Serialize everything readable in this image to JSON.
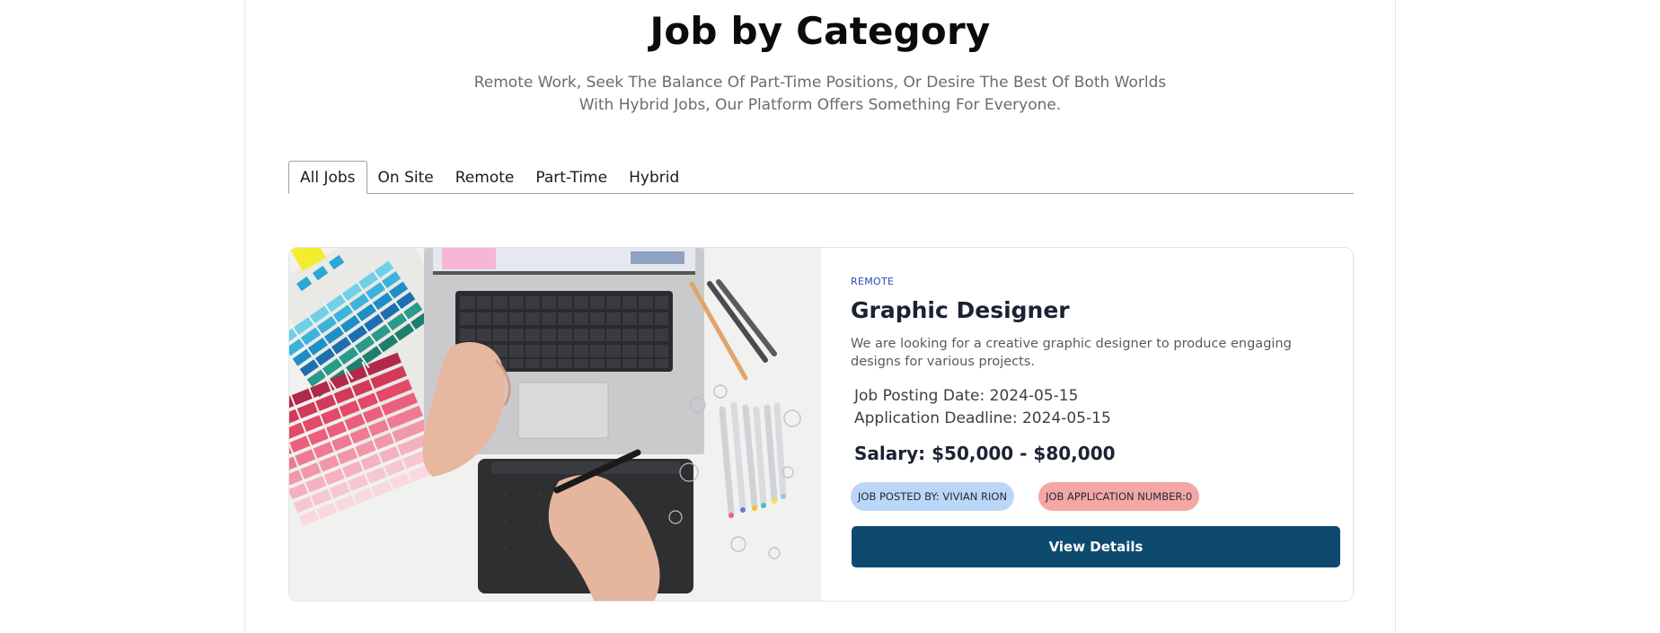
{
  "section": {
    "title": "Job by Category",
    "subtitle": "Remote Work, Seek The Balance Of Part-Time Positions, Or Desire The Best Of Both Worlds With Hybrid Jobs, Our Platform Offers Something For Everyone."
  },
  "tabs": [
    {
      "label": "All Jobs",
      "active": true
    },
    {
      "label": "On Site",
      "active": false
    },
    {
      "label": "Remote",
      "active": false
    },
    {
      "label": "Part-Time",
      "active": false
    },
    {
      "label": "Hybrid",
      "active": false
    }
  ],
  "job": {
    "type": "REMOTE",
    "title": "Graphic Designer",
    "description": "We are looking for a creative graphic designer to produce engaging designs for various projects.",
    "posting_date": "Job Posting Date: 2024-05-15",
    "deadline": "Application Deadline: 2024-05-15",
    "salary": "Salary: $50,000 - $80,000",
    "posted_by": "JOB POSTED BY: VIVIAN RION",
    "application_number": "JOB APPLICATION NUMBER:0",
    "button_label": "View Details",
    "image_alt": "photo-laptop-drawing-tablet-color-swatches"
  },
  "colors": {
    "accent_button": "#0e4a6e",
    "remote_tag": "#2947b8",
    "posted_pill": "#bcd6f7",
    "apps_pill": "#f4a7a4"
  }
}
